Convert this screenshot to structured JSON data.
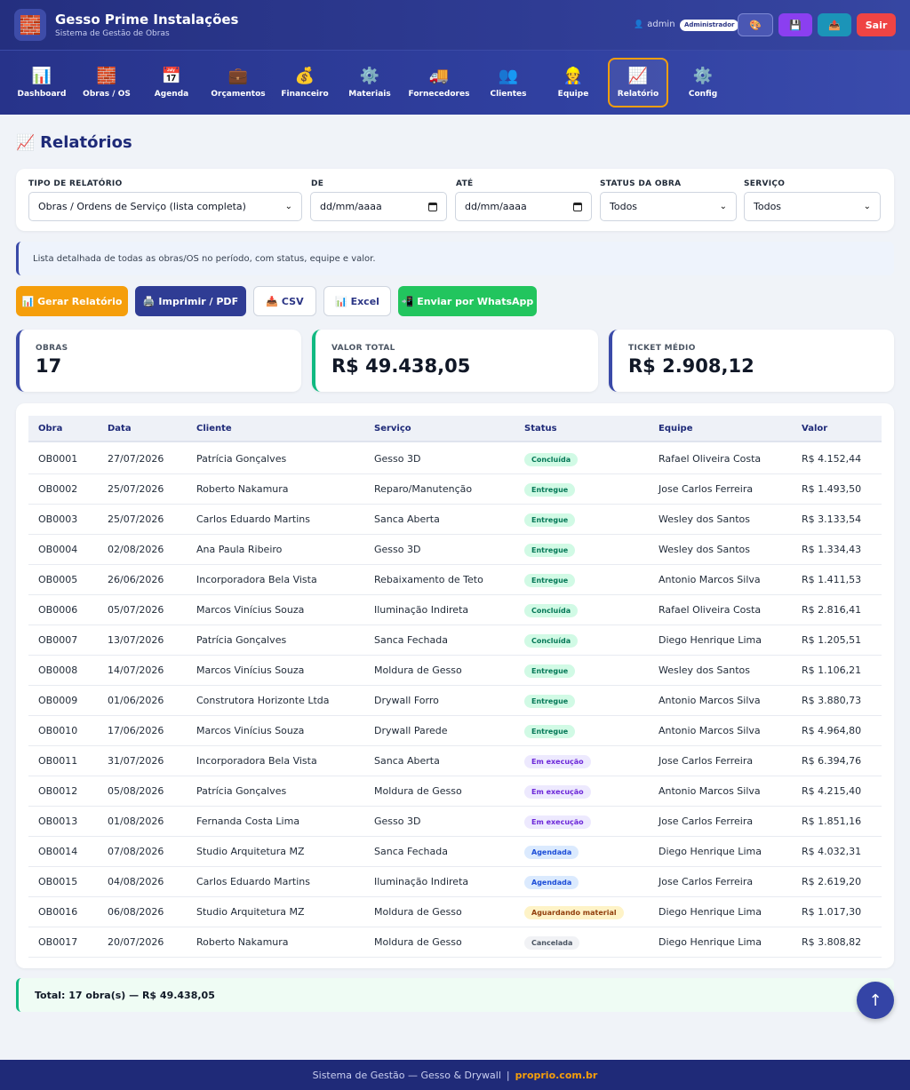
{
  "header": {
    "logo_icon": "🧱",
    "title": "Gesso Prime Instalações",
    "subtitle": "Sistema de Gestão de Obras",
    "user_icon": "👤",
    "user": "admin",
    "role": "Administrador",
    "theme_icon": "🎨",
    "save_icon": "💾",
    "upload_icon": "📤",
    "logout_label": "Sair"
  },
  "nav": [
    {
      "icon": "📊",
      "label": "Dashboard"
    },
    {
      "icon": "🧱",
      "label": "Obras / OS"
    },
    {
      "icon": "📅",
      "label": "Agenda"
    },
    {
      "icon": "💼",
      "label": "Orçamentos"
    },
    {
      "icon": "💰",
      "label": "Financeiro"
    },
    {
      "icon": "⚙️",
      "label": "Materiais"
    },
    {
      "icon": "🚚",
      "label": "Fornecedores"
    },
    {
      "icon": "👥",
      "label": "Clientes"
    },
    {
      "icon": "👷",
      "label": "Equipe"
    },
    {
      "icon": "📈",
      "label": "Relatório"
    },
    {
      "icon": "⚙️",
      "label": "Config"
    }
  ],
  "page": {
    "title_icon": "📈",
    "title": "Relatórios"
  },
  "filters": {
    "tipo_label": "TIPO DE RELATÓRIO",
    "tipo_value": "Obras / Ordens de Serviço (lista completa)",
    "de_label": "DE",
    "de_value": "dd/mm/aaaa",
    "ate_label": "ATÉ",
    "ate_value": "dd/mm/aaaa",
    "status_label": "STATUS DA OBRA",
    "status_value": "Todos",
    "servico_label": "SERVIÇO",
    "servico_value": "Todos"
  },
  "info_text": "Lista detalhada de todas as obras/OS no período, com status, equipe e valor.",
  "actions": {
    "gerar": "📊 Gerar Relatório",
    "imprimir": "🖨️ Imprimir / PDF",
    "csv": "📥 CSV",
    "excel": "📊 Excel",
    "whatsapp": "📲 Enviar por WhatsApp"
  },
  "stats": {
    "obras_label": "OBRAS",
    "obras_value": "17",
    "total_label": "VALOR TOTAL",
    "total_value": "R$ 49.438,05",
    "ticket_label": "TICKET MÉDIO",
    "ticket_value": "R$ 2.908,12"
  },
  "table": {
    "headers": [
      "Obra",
      "Data",
      "Cliente",
      "Serviço",
      "Status",
      "Equipe",
      "Valor"
    ],
    "status_colors": {
      "Concluída": {
        "bg": "#d1fae5",
        "fg": "#047857"
      },
      "Entregue": {
        "bg": "#d1fae5",
        "fg": "#047857"
      },
      "Em execução": {
        "bg": "#ede9fe",
        "fg": "#6d28d9"
      },
      "Agendada": {
        "bg": "#dbeafe",
        "fg": "#1d4ed8"
      },
      "Aguardando material": {
        "bg": "#fef3c7",
        "fg": "#92400e"
      },
      "Cancelada": {
        "bg": "#f1f2f5",
        "fg": "#4b5563"
      }
    },
    "rows": [
      {
        "obra": "OB0001",
        "data": "27/07/2026",
        "cliente": "Patrícia Gonçalves",
        "servico": "Gesso 3D",
        "status": "Concluída",
        "equipe": "Rafael Oliveira Costa",
        "valor": "R$ 4.152,44"
      },
      {
        "obra": "OB0002",
        "data": "25/07/2026",
        "cliente": "Roberto Nakamura",
        "servico": "Reparo/Manutenção",
        "status": "Entregue",
        "equipe": "Jose Carlos Ferreira",
        "valor": "R$ 1.493,50"
      },
      {
        "obra": "OB0003",
        "data": "25/07/2026",
        "cliente": "Carlos Eduardo Martins",
        "servico": "Sanca Aberta",
        "status": "Entregue",
        "equipe": "Wesley dos Santos",
        "valor": "R$ 3.133,54"
      },
      {
        "obra": "OB0004",
        "data": "02/08/2026",
        "cliente": "Ana Paula Ribeiro",
        "servico": "Gesso 3D",
        "status": "Entregue",
        "equipe": "Wesley dos Santos",
        "valor": "R$ 1.334,43"
      },
      {
        "obra": "OB0005",
        "data": "26/06/2026",
        "cliente": "Incorporadora Bela Vista",
        "servico": "Rebaixamento de Teto",
        "status": "Entregue",
        "equipe": "Antonio Marcos Silva",
        "valor": "R$ 1.411,53"
      },
      {
        "obra": "OB0006",
        "data": "05/07/2026",
        "cliente": "Marcos Vinícius Souza",
        "servico": "Iluminação Indireta",
        "status": "Concluída",
        "equipe": "Rafael Oliveira Costa",
        "valor": "R$ 2.816,41"
      },
      {
        "obra": "OB0007",
        "data": "13/07/2026",
        "cliente": "Patrícia Gonçalves",
        "servico": "Sanca Fechada",
        "status": "Concluída",
        "equipe": "Diego Henrique Lima",
        "valor": "R$ 1.205,51"
      },
      {
        "obra": "OB0008",
        "data": "14/07/2026",
        "cliente": "Marcos Vinícius Souza",
        "servico": "Moldura de Gesso",
        "status": "Entregue",
        "equipe": "Wesley dos Santos",
        "valor": "R$ 1.106,21"
      },
      {
        "obra": "OB0009",
        "data": "01/06/2026",
        "cliente": "Construtora Horizonte Ltda",
        "servico": "Drywall Forro",
        "status": "Entregue",
        "equipe": "Antonio Marcos Silva",
        "valor": "R$ 3.880,73"
      },
      {
        "obra": "OB0010",
        "data": "17/06/2026",
        "cliente": "Marcos Vinícius Souza",
        "servico": "Drywall Parede",
        "status": "Entregue",
        "equipe": "Antonio Marcos Silva",
        "valor": "R$ 4.964,80"
      },
      {
        "obra": "OB0011",
        "data": "31/07/2026",
        "cliente": "Incorporadora Bela Vista",
        "servico": "Sanca Aberta",
        "status": "Em execução",
        "equipe": "Jose Carlos Ferreira",
        "valor": "R$ 6.394,76"
      },
      {
        "obra": "OB0012",
        "data": "05/08/2026",
        "cliente": "Patrícia Gonçalves",
        "servico": "Moldura de Gesso",
        "status": "Em execução",
        "equipe": "Antonio Marcos Silva",
        "valor": "R$ 4.215,40"
      },
      {
        "obra": "OB0013",
        "data": "01/08/2026",
        "cliente": "Fernanda Costa Lima",
        "servico": "Gesso 3D",
        "status": "Em execução",
        "equipe": "Jose Carlos Ferreira",
        "valor": "R$ 1.851,16"
      },
      {
        "obra": "OB0014",
        "data": "07/08/2026",
        "cliente": "Studio Arquitetura MZ",
        "servico": "Sanca Fechada",
        "status": "Agendada",
        "equipe": "Diego Henrique Lima",
        "valor": "R$ 4.032,31"
      },
      {
        "obra": "OB0015",
        "data": "04/08/2026",
        "cliente": "Carlos Eduardo Martins",
        "servico": "Iluminação Indireta",
        "status": "Agendada",
        "equipe": "Jose Carlos Ferreira",
        "valor": "R$ 2.619,20"
      },
      {
        "obra": "OB0016",
        "data": "06/08/2026",
        "cliente": "Studio Arquitetura MZ",
        "servico": "Moldura de Gesso",
        "status": "Aguardando material",
        "equipe": "Diego Henrique Lima",
        "valor": "R$ 1.017,30"
      },
      {
        "obra": "OB0017",
        "data": "20/07/2026",
        "cliente": "Roberto Nakamura",
        "servico": "Moldura de Gesso",
        "status": "Cancelada",
        "equipe": "Diego Henrique Lima",
        "valor": "R$ 3.808,82"
      }
    ]
  },
  "total_text": "Total: 17 obra(s) — R$ 49.438,05",
  "fab_icon": "↑",
  "footer": {
    "text": "Sistema de Gestão — Gesso & Drywall",
    "separator": "|",
    "link": "proprio.com.br"
  }
}
